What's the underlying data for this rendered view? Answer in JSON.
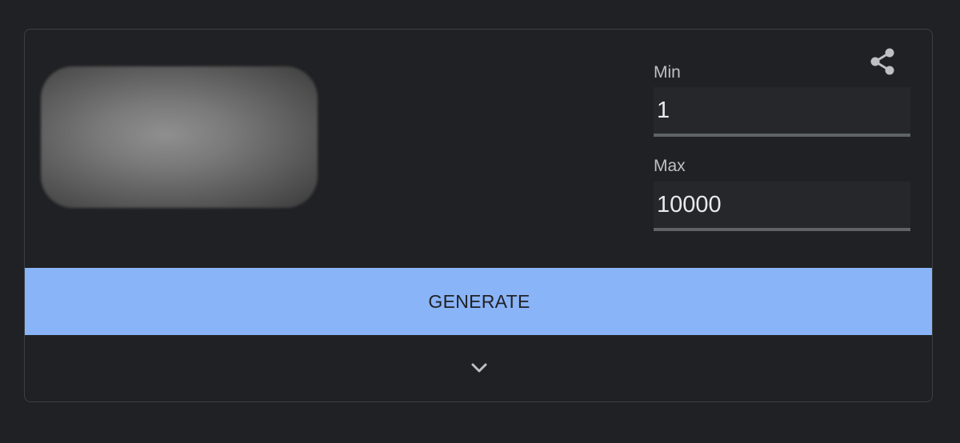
{
  "card": {
    "min_label": "Min",
    "min_value": "1",
    "max_label": "Max",
    "max_value": "10000",
    "generate_label": "GENERATE",
    "share_icon": "share-icon",
    "expand_icon": "chevron-down-icon"
  },
  "colors": {
    "background": "#202124",
    "button": "#8ab4f8",
    "field_bg": "#26272a",
    "field_underline": "#5f6368",
    "text": "#e8eaed"
  }
}
